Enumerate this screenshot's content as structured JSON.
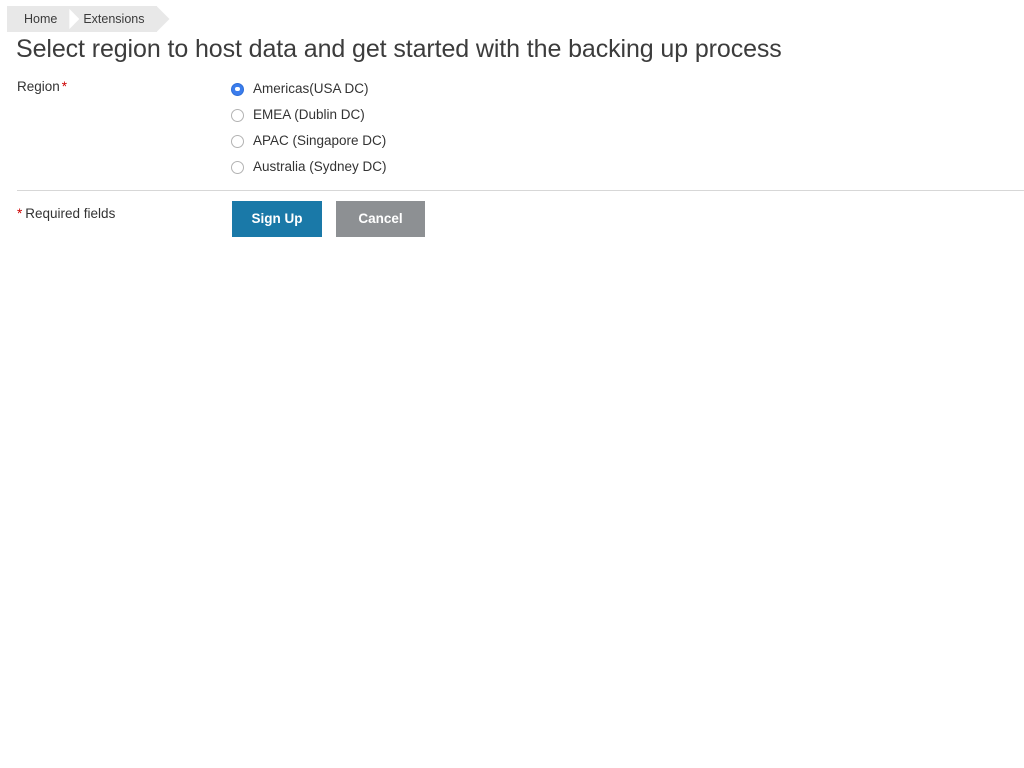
{
  "breadcrumb": {
    "items": [
      {
        "label": "Home"
      },
      {
        "label": "Extensions"
      }
    ]
  },
  "header": {
    "title": "Select region to host data and get started with the backing up process"
  },
  "form": {
    "region": {
      "label": "Region",
      "required_marker": "*",
      "selected": "Americas(USA DC)",
      "options": [
        {
          "label": "Americas(USA DC)",
          "checked": true
        },
        {
          "label": "EMEA (Dublin DC)",
          "checked": false
        },
        {
          "label": "APAC (Singapore DC)",
          "checked": false
        },
        {
          "label": "Australia (Sydney DC)",
          "checked": false
        }
      ]
    }
  },
  "footer": {
    "required_marker": "*",
    "required_note": "Required fields",
    "submit_label": "Sign Up",
    "cancel_label": "Cancel"
  },
  "colors": {
    "primary_button": "#1a79a8",
    "secondary_button": "#8d9093",
    "radio_selected": "#3b7ded",
    "required_star": "#cc0000",
    "breadcrumb_background": "#e8e8e8",
    "divider": "#d7d7d7"
  }
}
